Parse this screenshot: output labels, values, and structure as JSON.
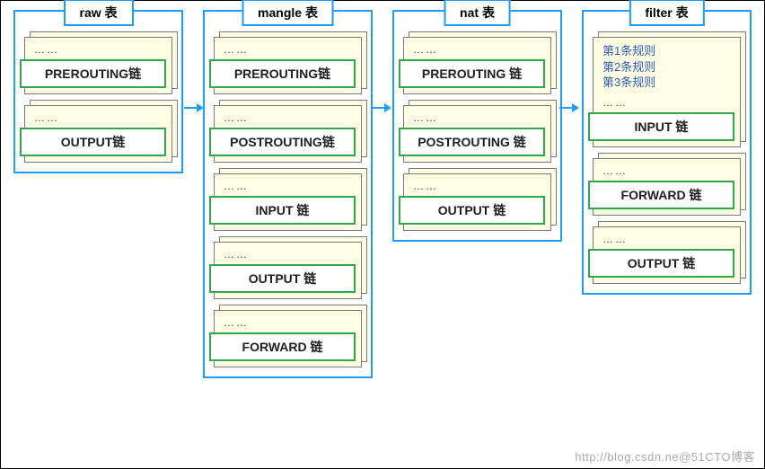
{
  "tables": [
    {
      "title": "raw 表",
      "chains": [
        {
          "dots": "……",
          "label": "PREROUTING链"
        },
        {
          "dots": "……",
          "label": "OUTPUT链"
        }
      ]
    },
    {
      "title": "mangle 表",
      "chains": [
        {
          "dots": "……",
          "label": "PREROUTING链"
        },
        {
          "dots": "……",
          "label": "POSTROUTING链"
        },
        {
          "dots": "……",
          "label": "INPUT 链"
        },
        {
          "dots": "……",
          "label": "OUTPUT 链"
        },
        {
          "dots": "……",
          "label": "FORWARD 链"
        }
      ]
    },
    {
      "title": "nat 表",
      "chains": [
        {
          "dots": "……",
          "label": "PREROUTING 链"
        },
        {
          "dots": "……",
          "label": "POSTROUTING 链"
        },
        {
          "dots": "……",
          "label": "OUTPUT 链"
        }
      ]
    },
    {
      "title": "filter 表",
      "chains": [
        {
          "rules": [
            "第1条规则",
            "第2条规则",
            "第3条规则"
          ],
          "dots": "……",
          "label": "INPUT 链"
        },
        {
          "dots": "……",
          "label": "FORWARD 链"
        },
        {
          "dots": "……",
          "label": "OUTPUT 链"
        }
      ]
    }
  ],
  "watermark": "http://blog.csdn.ne@51CTO博客",
  "colors": {
    "border": "#1e9bff",
    "chainBorder": "#2fa84a",
    "cardBg": "#fffde4"
  }
}
